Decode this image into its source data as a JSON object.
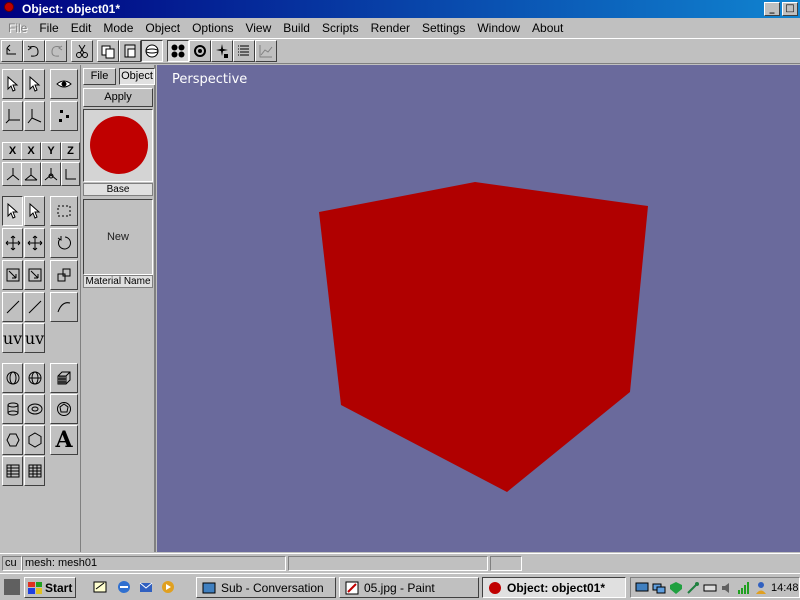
{
  "window": {
    "title": "Object: object01*"
  },
  "menubar": {
    "items": [
      {
        "label": "File",
        "disabled": true
      },
      {
        "label": "File"
      },
      {
        "label": "Edit"
      },
      {
        "label": "Mode"
      },
      {
        "label": "Object"
      },
      {
        "label": "Options"
      },
      {
        "label": "View"
      },
      {
        "label": "Build"
      },
      {
        "label": "Scripts"
      },
      {
        "label": "Render"
      },
      {
        "label": "Settings"
      },
      {
        "label": "Window"
      },
      {
        "label": "About"
      }
    ]
  },
  "material_panel": {
    "tabs": [
      "File",
      "Object"
    ],
    "apply_label": "Apply",
    "base_label": "Base",
    "new_label": "New",
    "material_name_label": "Material Name",
    "swatch_color": "#c00000"
  },
  "tool_palette": {
    "axis_labels": [
      "X",
      "X",
      "Y",
      "Z"
    ],
    "uv_label": "uv",
    "text_tool_label": "A"
  },
  "viewport": {
    "label": "Perspective",
    "background": "#6a6a9c",
    "object_color": "#b00000"
  },
  "statusbar": {
    "field1": "cu",
    "field2": "mesh: mesh01"
  },
  "taskbar": {
    "start_label": "Start",
    "tasks": [
      {
        "label": "Sub - Conversation"
      },
      {
        "label": "05.jpg - Paint"
      },
      {
        "label": "Object: object01*",
        "active": true
      }
    ],
    "clock": "14:48"
  }
}
